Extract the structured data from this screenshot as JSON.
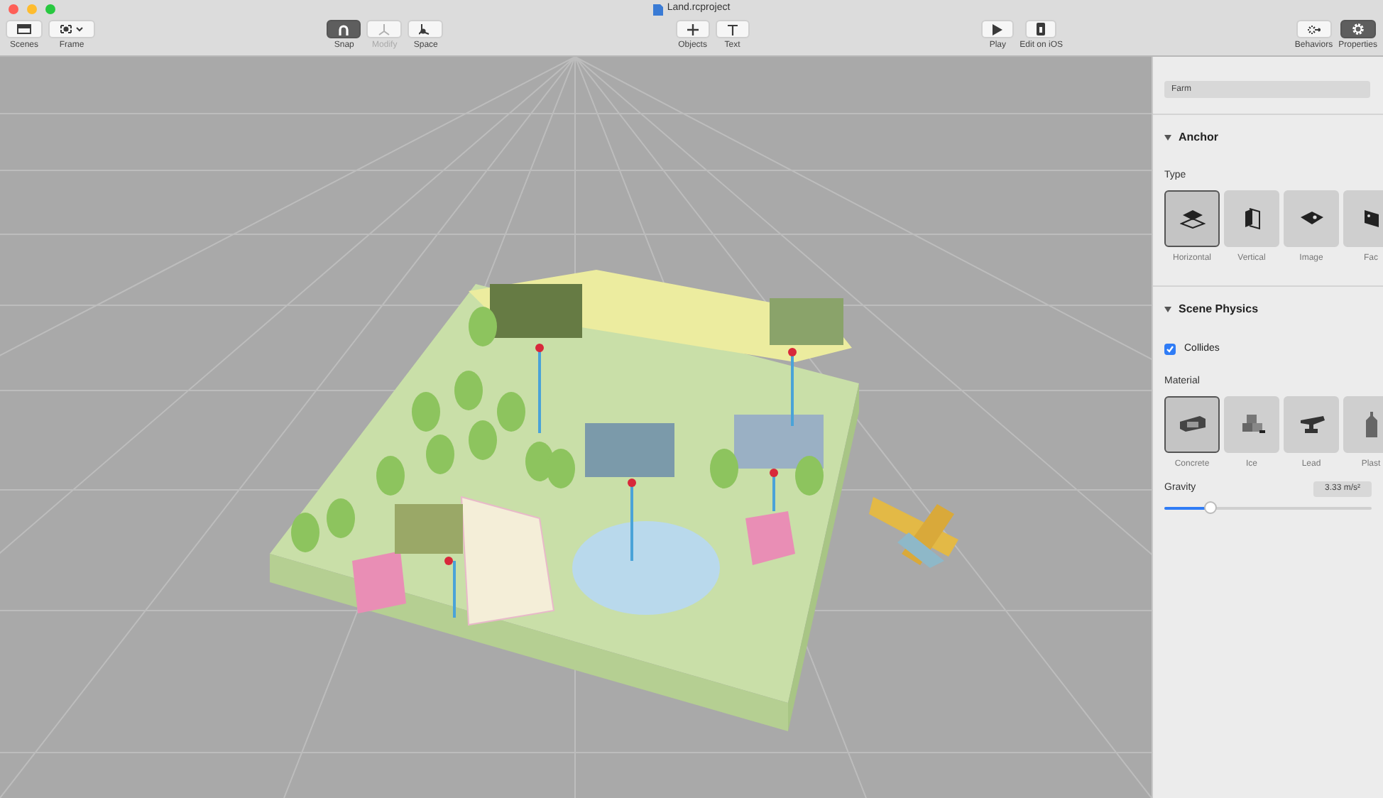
{
  "window": {
    "title": "Land.rcproject"
  },
  "toolbar_groups": [
    {
      "tools": [
        {
          "kind": "scenes",
          "label": "Scenes",
          "on": false,
          "disabled": false
        },
        {
          "kind": "frame",
          "label": "Frame",
          "on": false,
          "disabled": false
        }
      ]
    },
    {
      "tools": [
        {
          "kind": "snap",
          "label": "Snap",
          "on": true,
          "disabled": false
        },
        {
          "kind": "modify",
          "label": "Modify",
          "on": false,
          "disabled": true
        },
        {
          "kind": "space",
          "label": "Space",
          "on": false,
          "disabled": false
        }
      ]
    },
    {
      "tools": [
        {
          "kind": "objects",
          "label": "Objects",
          "on": false,
          "disabled": false
        },
        {
          "kind": "text",
          "label": "Text",
          "on": false,
          "disabled": false
        }
      ]
    },
    {
      "tools": [
        {
          "kind": "play",
          "label": "Play",
          "on": false,
          "disabled": false
        },
        {
          "kind": "ios",
          "label": "Edit on iOS",
          "on": false,
          "disabled": false
        }
      ]
    },
    {
      "tools": [
        {
          "kind": "behaviors",
          "label": "Behaviors",
          "on": false,
          "disabled": false
        },
        {
          "kind": "properties",
          "label": "Properties",
          "on": true,
          "disabled": false
        }
      ]
    }
  ],
  "inspector": {
    "name_field": {
      "value": "Farm"
    },
    "anchor": {
      "title": "Anchor",
      "expanded": true,
      "type_label": "Type",
      "types": [
        {
          "kind": "horizontal",
          "label": "Horizontal",
          "selected": true
        },
        {
          "kind": "vertical",
          "label": "Vertical",
          "selected": false
        },
        {
          "kind": "image",
          "label": "Image",
          "selected": false
        },
        {
          "kind": "face",
          "label": "Fac",
          "selected": false
        }
      ]
    },
    "physics": {
      "title": "Scene Physics",
      "expanded": true,
      "collides": {
        "label": "Collides",
        "checked": true
      },
      "material_label": "Material",
      "materials": [
        {
          "kind": "concrete",
          "label": "Concrete",
          "selected": true
        },
        {
          "kind": "ice",
          "label": "Ice",
          "selected": false
        },
        {
          "kind": "lead",
          "label": "Lead",
          "selected": false
        },
        {
          "kind": "plastic",
          "label": "Plast",
          "selected": false
        }
      ],
      "gravity": {
        "label": "Gravity",
        "reading": "3.33 m/s²",
        "level": 0.22
      }
    }
  }
}
